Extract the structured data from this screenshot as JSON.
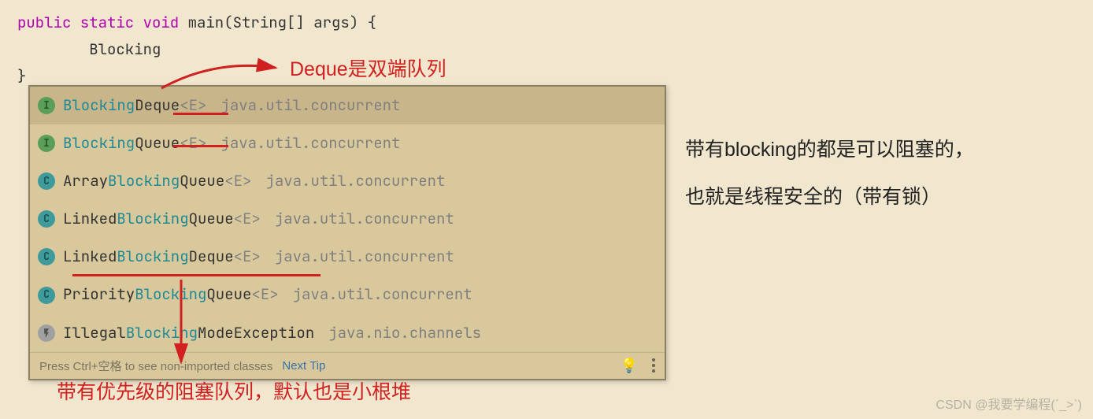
{
  "code": {
    "signature_pre": "public static void ",
    "method": "main",
    "params": "(String[] args) {",
    "typed": "        Blocking",
    "close": "}"
  },
  "popup": {
    "items": [
      {
        "badge": "I",
        "name_parts": [
          [
            "hl",
            "Blocking"
          ],
          [
            "plain",
            "Deque"
          ]
        ],
        "generic": "<E>",
        "pkg": "java.util.concurrent",
        "selected": true
      },
      {
        "badge": "I",
        "name_parts": [
          [
            "hl",
            "Blocking"
          ],
          [
            "plain",
            "Queue"
          ]
        ],
        "generic": "<E>",
        "pkg": "java.util.concurrent",
        "selected": false
      },
      {
        "badge": "C",
        "name_parts": [
          [
            "plain",
            "Array"
          ],
          [
            "hl",
            "Blocking"
          ],
          [
            "plain",
            "Queue"
          ]
        ],
        "generic": "<E>",
        "pkg": "java.util.concurrent",
        "selected": false
      },
      {
        "badge": "C",
        "name_parts": [
          [
            "plain",
            "Linked"
          ],
          [
            "hl",
            "Blocking"
          ],
          [
            "plain",
            "Queue"
          ]
        ],
        "generic": "<E>",
        "pkg": "java.util.concurrent",
        "selected": false
      },
      {
        "badge": "C",
        "name_parts": [
          [
            "plain",
            "Linked"
          ],
          [
            "hl",
            "Blocking"
          ],
          [
            "plain",
            "Deque"
          ]
        ],
        "generic": "<E>",
        "pkg": "java.util.concurrent",
        "selected": false
      },
      {
        "badge": "C",
        "name_parts": [
          [
            "plain",
            "Priority"
          ],
          [
            "hl",
            "Blocking"
          ],
          [
            "plain",
            "Queue"
          ]
        ],
        "generic": "<E>",
        "pkg": "java.util.concurrent",
        "selected": false
      },
      {
        "badge": "L",
        "name_parts": [
          [
            "plain",
            "Illegal"
          ],
          [
            "hl",
            "Blocking"
          ],
          [
            "plain",
            "ModeException"
          ]
        ],
        "generic": "",
        "pkg": "java.nio.channels",
        "selected": false
      }
    ],
    "footer_hint": "Press Ctrl+空格 to see non-imported classes",
    "next_tip": "Next Tip"
  },
  "annotations": {
    "deque_note": "Deque是双端队列",
    "blocking_note_line1": "带有blocking的都是可以阻塞的，",
    "blocking_note_line2": "也就是线程安全的（带有锁）",
    "priority_note": "带有优先级的阻塞队列，默认也是小根堆"
  },
  "watermark": "CSDN @我要学编程(ˊ_>ˋ)"
}
